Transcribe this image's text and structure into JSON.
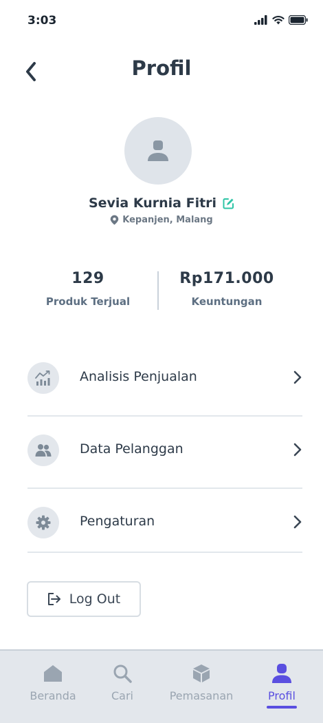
{
  "status_bar": {
    "time": "3:03"
  },
  "header": {
    "title": "Profil"
  },
  "profile": {
    "name": "Sevia Kurnia Fitri",
    "location": "Kepanjen, Malang"
  },
  "stats": [
    {
      "value": "129",
      "label": "Produk Terjual"
    },
    {
      "value": "Rp171.000",
      "label": "Keuntungan"
    }
  ],
  "menu": [
    {
      "label": "Analisis Penjualan",
      "icon": "chart-icon"
    },
    {
      "label": "Data Pelanggan",
      "icon": "users-icon"
    },
    {
      "label": "Pengaturan",
      "icon": "gear-icon"
    }
  ],
  "logout": {
    "label": "Log Out"
  },
  "bottom_nav": [
    {
      "label": "Beranda",
      "icon": "home-icon"
    },
    {
      "label": "Cari",
      "icon": "search-icon"
    },
    {
      "label": "Pemasanan",
      "icon": "box-icon"
    },
    {
      "label": "Profil",
      "icon": "user-icon",
      "active": true
    }
  ],
  "colors": {
    "accent": "#5a4fe0",
    "edit": "#2ec4a6",
    "icon_gray": "#7d8a97",
    "nav_gray": "#9aa5b1"
  }
}
